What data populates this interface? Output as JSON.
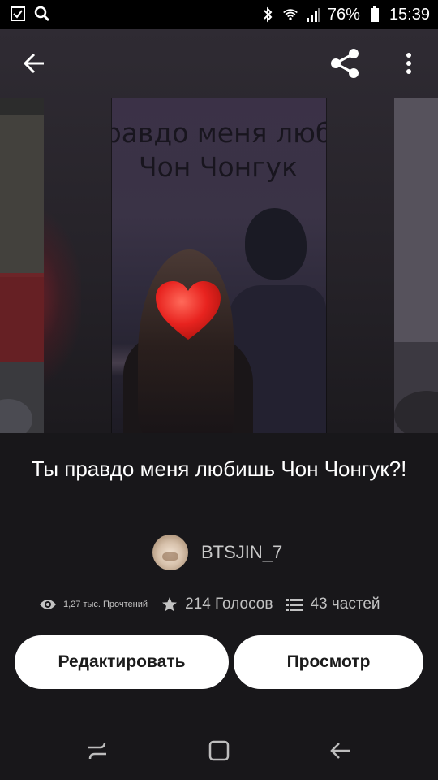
{
  "status_bar": {
    "battery": "76%",
    "time": "15:39",
    "icons": [
      "checkbox-notification-icon",
      "search-icon",
      "bluetooth-icon",
      "wifi-icon",
      "signal-icon",
      "battery-icon"
    ]
  },
  "app_bar": {
    "icons": [
      "back-arrow-icon",
      "share-icon",
      "more-vert-icon"
    ]
  },
  "cover": {
    "title_lines": [
      "равдо меня люб",
      "Чон Чонгук"
    ]
  },
  "story": {
    "title": "Ты правдо меня любишь Чон Чонгук?!",
    "author": "BTSJIN_7"
  },
  "stats": {
    "reads": "1,27 тыс. Прочтений",
    "votes": "214 Голосов",
    "parts": "43 частей"
  },
  "buttons": {
    "edit": "Редактировать",
    "view": "Просмотр"
  },
  "nav": {
    "icons": [
      "recents-icon",
      "home-icon",
      "back-icon"
    ]
  },
  "colors": {
    "background": "#18171a",
    "button_bg": "#ffffff",
    "heart": "#e8231f"
  }
}
